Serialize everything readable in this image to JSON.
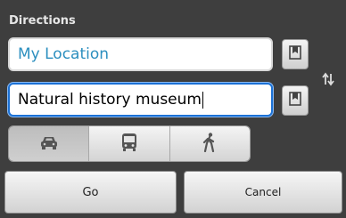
{
  "dialog": {
    "title": "Directions",
    "from_value": "My Location",
    "to_value": "Natural history museum",
    "travel_modes": [
      "car",
      "bus",
      "walking"
    ],
    "selected_mode": "car",
    "go_label": "Go",
    "cancel_label": "Cancel"
  },
  "icons": {
    "bookmark_from": "bookmark-icon",
    "bookmark_to": "bookmark-icon",
    "swap": "swap-arrows-icon",
    "car": "car-icon",
    "bus": "bus-icon",
    "walk": "walk-icon"
  },
  "colors": {
    "background": "#3e3e3e",
    "location_text": "#2c8fbf",
    "focus_border": "#1c72d6"
  }
}
